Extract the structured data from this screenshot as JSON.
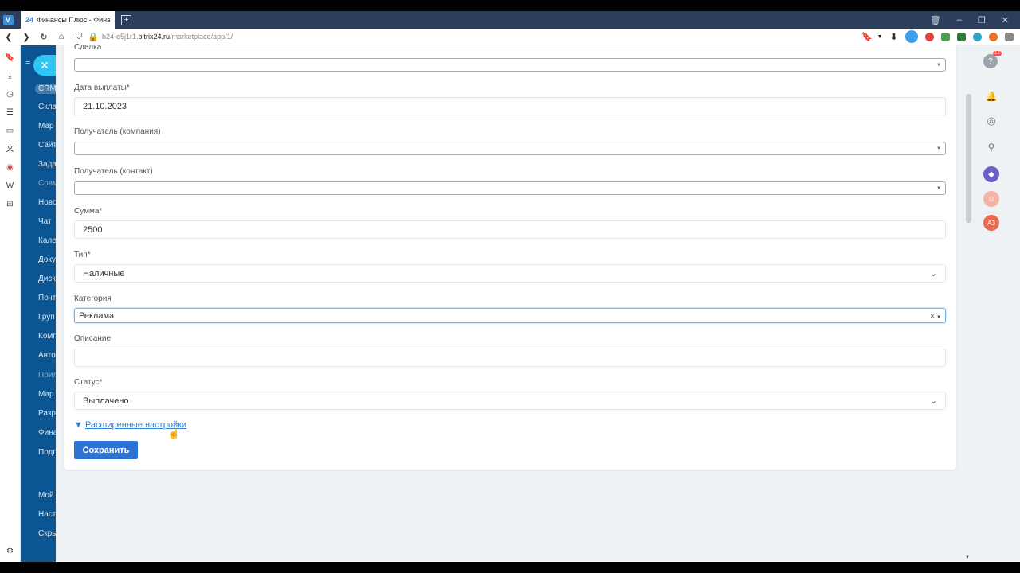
{
  "browser": {
    "logo_letter": "V",
    "tab_icon": "24",
    "tab_title": "Финансы Плюс - Финансо",
    "url_prefix": "b24-o5j1r1.",
    "url_domain": "bitrix24.ru",
    "url_path": "/marketplace/app/1/"
  },
  "bx_menu": [
    "CRM",
    "Скла",
    "Мар",
    "Сайт",
    "Зада",
    "Совм",
    "Ново",
    "Чат",
    "Кале",
    "Доку",
    "Диск",
    "Почт",
    "Груп",
    "Комп",
    "Авто",
    "Прил",
    "Мар",
    "Разр",
    "Фина",
    "Подг",
    "Мой",
    "Наст",
    "Скры"
  ],
  "form": {
    "deal_label": "Сделка",
    "deal_value": "",
    "payment_date_label": "Дата выплаты*",
    "payment_date_value": "21.10.2023",
    "recipient_company_label": "Получатель (компания)",
    "recipient_company_value": "",
    "recipient_contact_label": "Получатель (контакт)",
    "recipient_contact_value": "",
    "amount_label": "Сумма*",
    "amount_value": "2500",
    "type_label": "Тип*",
    "type_value": "Наличные",
    "category_label": "Категория",
    "category_value": "Реклама",
    "description_label": "Описание",
    "description_value": "",
    "status_label": "Статус*",
    "status_value": "Выплачено",
    "advanced_link": "Расширенные настройки",
    "advanced_marker": "▼",
    "save_label": "Сохранить"
  },
  "right_panel": {
    "help_badge": "12",
    "avatar_initials": "АЗ"
  },
  "colors": {
    "bx_sidebar": "#0b5592",
    "accent": "#2fc6f6",
    "save_button": "#2d73d6",
    "link": "#2f7ed8",
    "avatar": "#e9694c"
  }
}
